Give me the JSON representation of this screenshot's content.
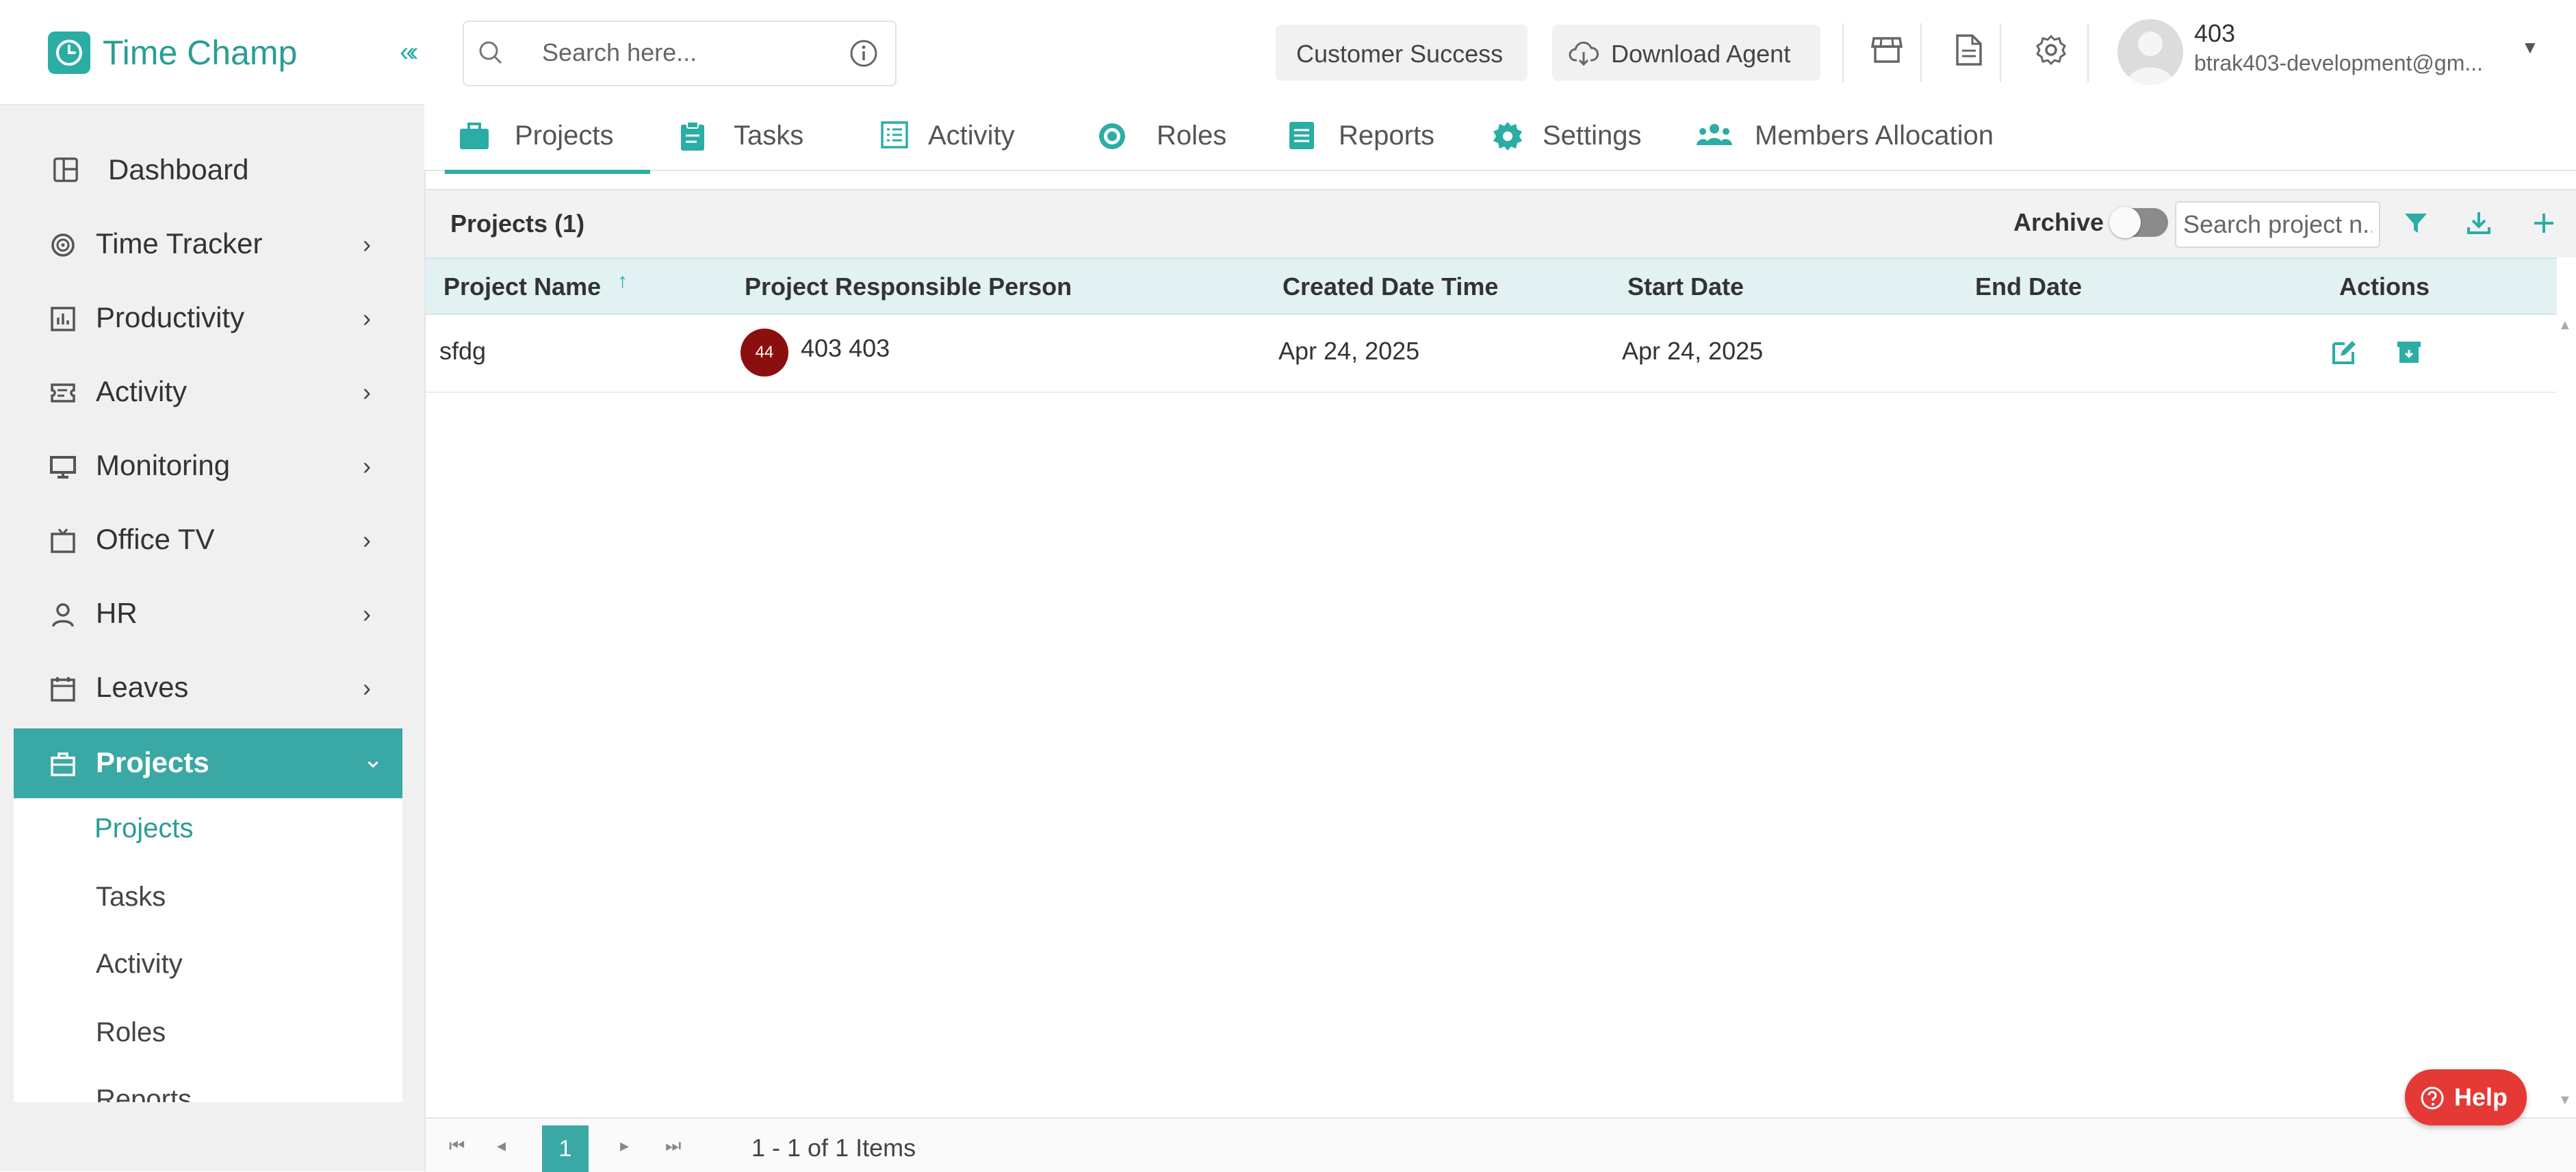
{
  "brand": {
    "name": "Time Champ",
    "accent_color": "#2bada5"
  },
  "sidebar": {
    "items": [
      {
        "label": "Dashboard",
        "icon": "dashboard-icon",
        "has_arrow": false
      },
      {
        "label": "Time Tracker",
        "icon": "time-tracker-icon",
        "has_arrow": true
      },
      {
        "label": "Productivity",
        "icon": "productivity-icon",
        "has_arrow": true
      },
      {
        "label": "Activity",
        "icon": "activity-icon",
        "has_arrow": true
      },
      {
        "label": "Monitoring",
        "icon": "monitor-icon",
        "has_arrow": true
      },
      {
        "label": "Office TV",
        "icon": "tv-icon",
        "has_arrow": true
      },
      {
        "label": "HR",
        "icon": "person-icon",
        "has_arrow": true
      },
      {
        "label": "Leaves",
        "icon": "calendar-icon",
        "has_arrow": true
      },
      {
        "label": "Projects",
        "icon": "briefcase-icon",
        "has_arrow": true,
        "active": true
      }
    ],
    "sub_items": [
      {
        "label": "Projects",
        "active": true
      },
      {
        "label": "Tasks"
      },
      {
        "label": "Activity"
      },
      {
        "label": "Roles"
      },
      {
        "label": "Reports"
      }
    ]
  },
  "header": {
    "search_placeholder": "Search here...",
    "customer_success_label": "Customer Success",
    "download_agent_label": "Download Agent",
    "user_name": "403",
    "user_email": "btrak403-development@gm..."
  },
  "tabs": [
    {
      "label": "Projects",
      "icon": "briefcase-icon",
      "active": true
    },
    {
      "label": "Tasks",
      "icon": "clipboard-icon"
    },
    {
      "label": "Activity",
      "icon": "list-icon"
    },
    {
      "label": "Roles",
      "icon": "roles-gear-icon"
    },
    {
      "label": "Reports",
      "icon": "report-icon"
    },
    {
      "label": "Settings",
      "icon": "settings-icon"
    },
    {
      "label": "Members Allocation",
      "icon": "members-icon"
    }
  ],
  "grid": {
    "title": "Projects (1)",
    "archive_label": "Archive",
    "archive_on": false,
    "search_placeholder": "Search project n...",
    "columns": {
      "name": "Project Name",
      "responsible": "Project Responsible Person",
      "created": "Created Date Time",
      "start": "Start Date",
      "end": "End Date",
      "actions": "Actions"
    },
    "rows": [
      {
        "name": "sfdg",
        "responsible_avatar": "44",
        "responsible": "403 403",
        "created": "Apr 24, 2025",
        "start": "Apr 24, 2025",
        "end": ""
      }
    ]
  },
  "pager": {
    "current_page": "1",
    "info": "1 - 1 of 1 Items"
  },
  "help": {
    "label": "Help"
  }
}
